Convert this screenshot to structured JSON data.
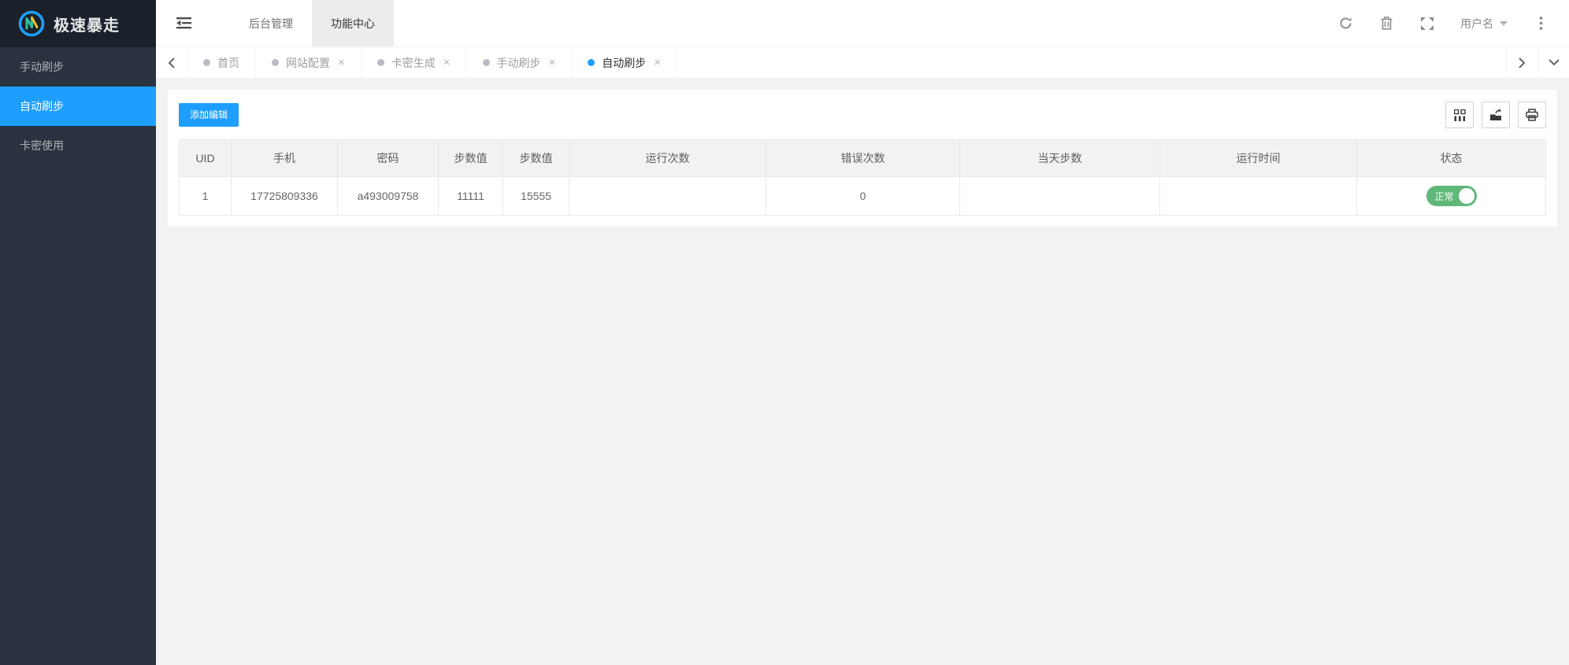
{
  "app": {
    "title": "极速暴走"
  },
  "colors": {
    "accent": "#1E9FFF",
    "success": "#5FB878",
    "sidebar_bg": "#2a333f",
    "logo_bg": "#1b212a",
    "page_bg": "#f2f2f2"
  },
  "sidebar": {
    "items": [
      {
        "label": "手动刷步",
        "active": false
      },
      {
        "label": "自动刷步",
        "active": true
      },
      {
        "label": "卡密使用",
        "active": false
      }
    ]
  },
  "header": {
    "nav": [
      {
        "label": "后台管理",
        "active": false
      },
      {
        "label": "功能中心",
        "active": true
      }
    ],
    "user": {
      "label": "用户名"
    },
    "icons": [
      "collapse-menu-icon",
      "refresh-icon",
      "trash-icon",
      "fullscreen-icon",
      "caret-down-icon",
      "more-vertical-icon"
    ]
  },
  "tabbar": {
    "close_glyph": "×",
    "icons": [
      "chevron-left-icon",
      "chevron-right-icon",
      "chevron-down-icon"
    ],
    "tabs": [
      {
        "label": "首页",
        "active": false,
        "closable": false
      },
      {
        "label": "网站配置",
        "active": false,
        "closable": true
      },
      {
        "label": "卡密生成",
        "active": false,
        "closable": true
      },
      {
        "label": "手动刷步",
        "active": false,
        "closable": true
      },
      {
        "label": "自动刷步",
        "active": true,
        "closable": true
      }
    ]
  },
  "main": {
    "add_button": "添加编辑",
    "table_tool_icons": [
      "filter-columns-icon",
      "export-icon",
      "print-icon"
    ],
    "table": {
      "columns": [
        "UID",
        "手机",
        "密码",
        "步数值",
        "步数值",
        "运行次数",
        "错误次数",
        "当天步数",
        "运行时间",
        "状态"
      ],
      "rows": [
        {
          "uid": "1",
          "phone": "17725809336",
          "password": "a493009758",
          "step_min": "11111",
          "step_max": "15555",
          "run_count": "",
          "error_count": "0",
          "today_steps": "",
          "run_time": "",
          "status": "正常",
          "status_on": true
        }
      ]
    }
  }
}
